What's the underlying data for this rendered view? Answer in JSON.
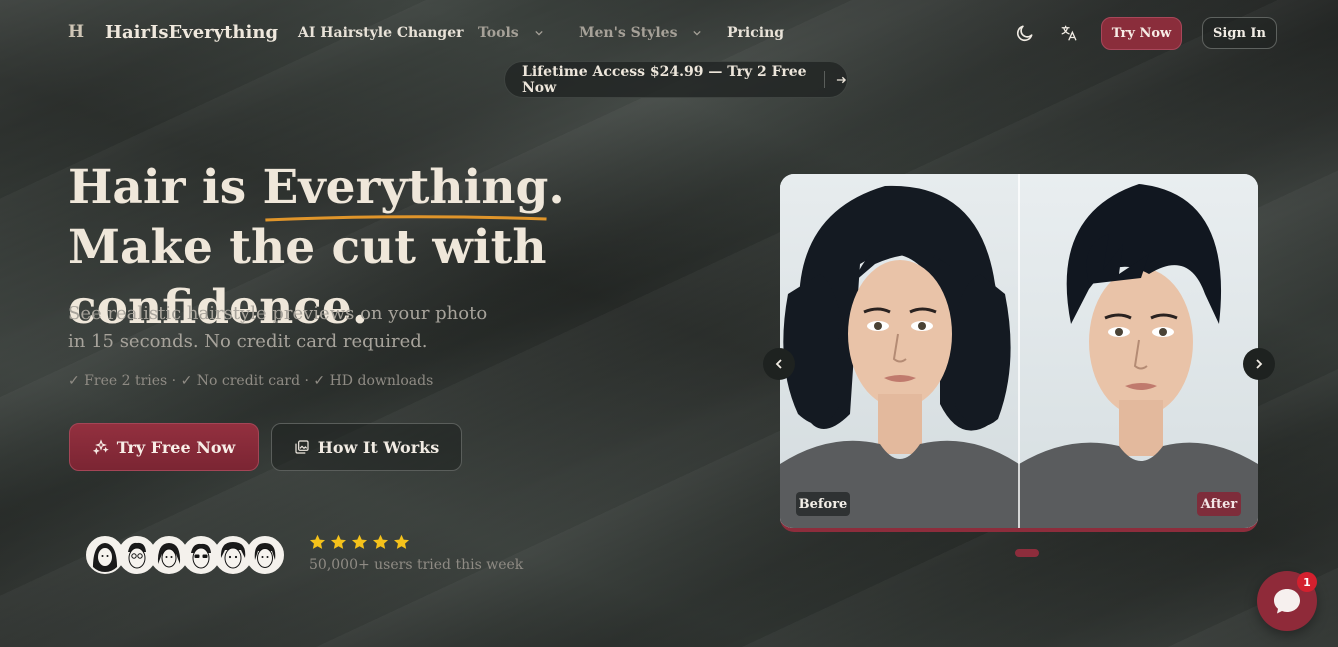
{
  "nav": {
    "logo_mark": "H",
    "brand": "HairIsEverything",
    "links": [
      {
        "label": "AI Hairstyle Changer"
      },
      {
        "label": "Tools"
      },
      {
        "label": "Men's Styles"
      },
      {
        "label": "Pricing"
      }
    ],
    "try_now": "Try Now",
    "sign_in": "Sign In"
  },
  "promo": {
    "text": "Lifetime Access $24.99 — Try 2 Free Now"
  },
  "hero": {
    "title_part1": "Hair is ",
    "title_highlight": "Everything",
    "title_part2": ". Make the cut with confidence.",
    "subtitle": "See realistic hairstyle previews on your photo in 15 seconds. No credit card required.",
    "checks": "✓ Free 2 tries · ✓ No credit card · ✓ HD downloads",
    "primary_cta": "Try Free Now",
    "secondary_cta": "How It Works",
    "rating_stars": 5,
    "social_proof": "50,000+ users tried this week"
  },
  "slider": {
    "before_label": "Before",
    "after_label": "After",
    "active_slide": 1
  },
  "chat": {
    "unread_count": "1"
  },
  "colors": {
    "accent": "#8d2d3c",
    "underline": "#e0952a",
    "star": "#f5c21b",
    "background": "#2f3431"
  }
}
